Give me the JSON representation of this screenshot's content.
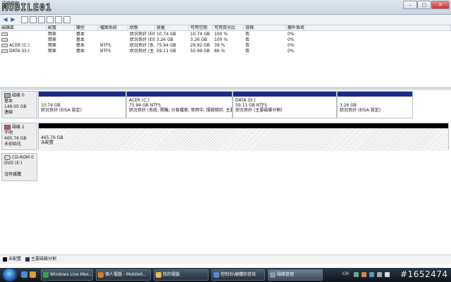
{
  "window": {
    "title": "磁碟管理",
    "brand": "MOBILE01"
  },
  "toolbar": {
    "back_icon": "back-arrow-icon",
    "forward_icon": "forward-arrow-icon"
  },
  "volumes": {
    "columns": [
      "磁碟區",
      "配置",
      "類型",
      "檔案系統",
      "狀態",
      "容量",
      "可用空間",
      "可用百分比",
      "容錯",
      "額外負荷"
    ],
    "rows": [
      [
        "",
        "簡單",
        "基本",
        "",
        "狀況良好 (EISA...",
        "10.74 GB",
        "10.74 GB",
        "100 %",
        "否",
        "0%"
      ],
      [
        "",
        "簡單",
        "基本",
        "",
        "狀況良好 (EISA...",
        "3.26 GB",
        "3.26 GB",
        "100 %",
        "否",
        "0%"
      ],
      [
        "ACER (C:)",
        "簡單",
        "基本",
        "NTFS",
        "狀況良好 (系...",
        "75.94 GB",
        "29.92 GB",
        "39 %",
        "否",
        "0%"
      ],
      [
        "DATA (D:)",
        "簡單",
        "基本",
        "NTFS",
        "狀況良好 (主...",
        "59.11 GB",
        "50.99 GB",
        "86 %",
        "否",
        "0%"
      ]
    ]
  },
  "disks": [
    {
      "name": "磁碟 0",
      "type": "基本",
      "size": "149.05 GB",
      "status": "連線",
      "partitions": [
        {
          "name": "",
          "size": "10.74 GB",
          "status": "狀況良好 (EISA 設定)"
        },
        {
          "name": "ACER (C:)",
          "size": "75.94 GB NTFS",
          "status": "狀況良好 (系統, 開機, 分頁檔案, 使用中, 損毀傾印, 主要"
        },
        {
          "name": "DATA (D:)",
          "size": "59.11 GB NTFS",
          "status": "狀況良好 (主要磁碟分割)"
        },
        {
          "name": "",
          "size": "3.26 GB",
          "status": "狀況良好 (EISA 設定)"
        }
      ]
    },
    {
      "name": "磁碟 2",
      "type": "不明",
      "size": "465.76 GB",
      "status": "未初始化",
      "partitions": [
        {
          "size": "465.76 GB",
          "status": "未配置"
        }
      ]
    },
    {
      "name": "CD-ROM 0",
      "type": "DVD (E:)",
      "size": "",
      "status": "沒有媒體"
    }
  ],
  "legend": {
    "unallocated": "未配置",
    "primary": "主要磁碟分割",
    "colors": {
      "unallocated": "#000000",
      "primary": "#1c2a88"
    }
  },
  "taskbar": {
    "buttons": [
      {
        "label": "Windows Live Mes...",
        "icon_color": "#3aa04a"
      },
      {
        "label": "個人電腦 - Mobile0...",
        "icon_color": "#e07a1e"
      },
      {
        "label": "我的電腦",
        "icon_color": "#e6c24a"
      },
      {
        "label": "控制台\\硬體和音效",
        "icon_color": "#5a8bd0"
      },
      {
        "label": "磁碟管理",
        "icon_color": "#8a99a8"
      }
    ],
    "tray_lang": "CH"
  },
  "watermark": "#1652474"
}
